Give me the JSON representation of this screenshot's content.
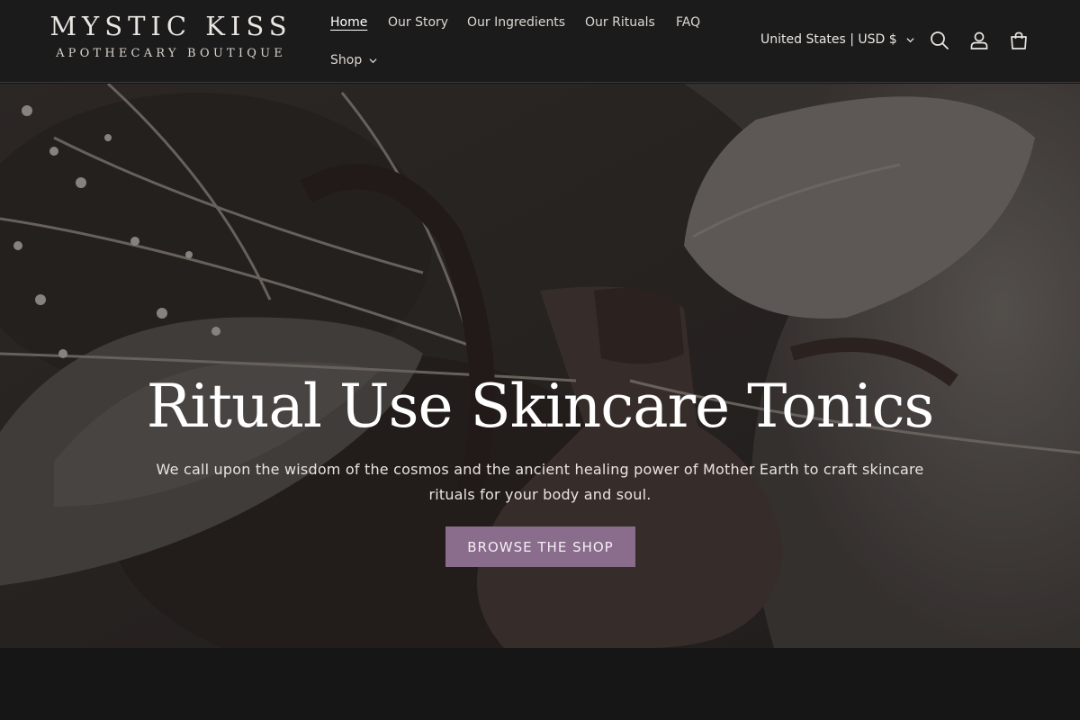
{
  "brand": {
    "title": "MYSTIC KISS",
    "subtitle": "APOTHECARY BOUTIQUE"
  },
  "nav": {
    "items": [
      {
        "label": "Home",
        "active": true
      },
      {
        "label": "Our Story"
      },
      {
        "label": "Our Ingredients"
      },
      {
        "label": "Our Rituals"
      },
      {
        "label": "FAQ"
      },
      {
        "label": "Shop",
        "has_dropdown": true
      }
    ]
  },
  "header": {
    "country_label": "United States | USD $",
    "icons": [
      "search-icon",
      "account-icon",
      "cart-icon"
    ]
  },
  "hero": {
    "title": "Ritual Use Skincare Tonics",
    "text": "We call upon the wisdom of the cosmos and the ancient healing power of Mother Earth to craft skincare rituals for your body and soul.",
    "button_label": "BROWSE THE SHOP"
  },
  "colors": {
    "header_bg": "#1c1b1b",
    "accent": "#8a6c8c",
    "page_bg": "#161617"
  }
}
